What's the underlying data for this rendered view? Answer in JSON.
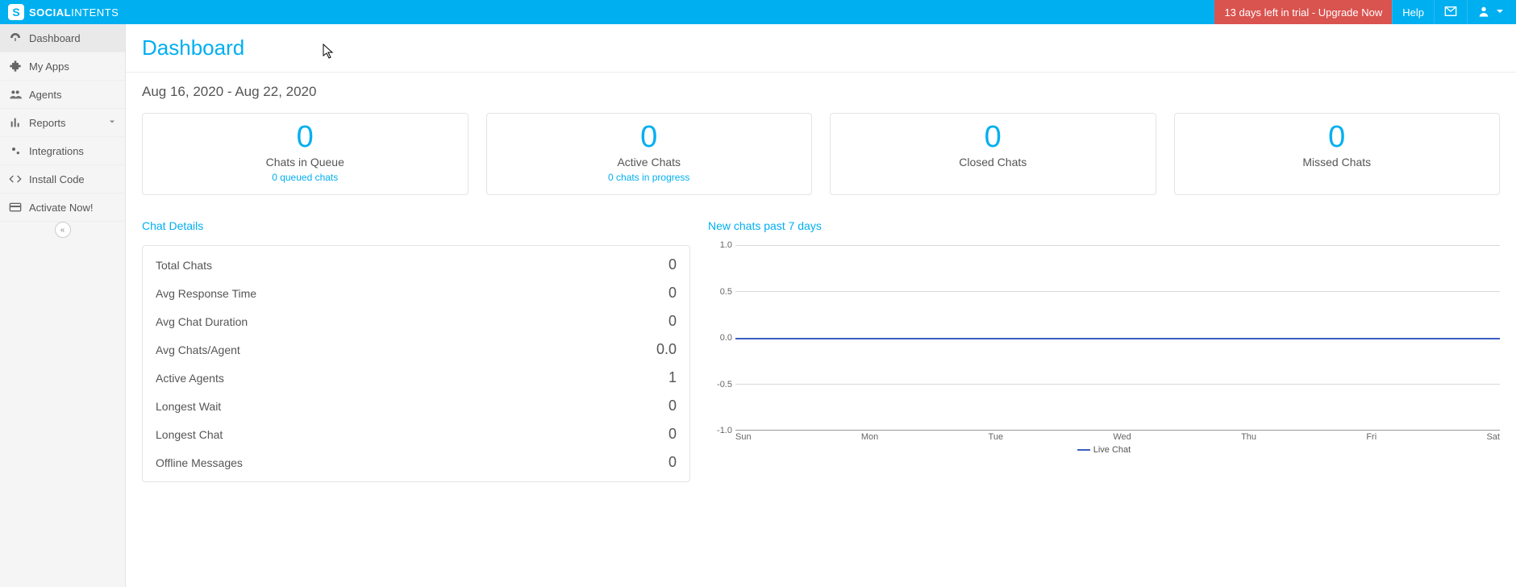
{
  "brand": {
    "name_a": "SOCIAL",
    "name_b": "INTENTS",
    "badge": "S"
  },
  "topbar": {
    "upgrade": "13 days left in trial - Upgrade Now",
    "help": "Help"
  },
  "sidebar": {
    "items": [
      {
        "label": "Dashboard"
      },
      {
        "label": "My Apps"
      },
      {
        "label": "Agents"
      },
      {
        "label": "Reports"
      },
      {
        "label": "Integrations"
      },
      {
        "label": "Install Code"
      },
      {
        "label": "Activate Now!"
      }
    ]
  },
  "page": {
    "title": "Dashboard",
    "date_range": "Aug 16, 2020 - Aug 22, 2020"
  },
  "cards": [
    {
      "value": "0",
      "label": "Chats in Queue",
      "sub": "0 queued chats"
    },
    {
      "value": "0",
      "label": "Active Chats",
      "sub": "0 chats in progress"
    },
    {
      "value": "0",
      "label": "Closed Chats"
    },
    {
      "value": "0",
      "label": "Missed Chats"
    }
  ],
  "chat_details": {
    "title": "Chat Details",
    "rows": [
      {
        "label": "Total Chats",
        "value": "0"
      },
      {
        "label": "Avg Response Time",
        "value": "0"
      },
      {
        "label": "Avg Chat Duration",
        "value": "0"
      },
      {
        "label": "Avg Chats/Agent",
        "value": "0.0"
      },
      {
        "label": "Active Agents",
        "value": "1"
      },
      {
        "label": "Longest Wait",
        "value": "0"
      },
      {
        "label": "Longest Chat",
        "value": "0"
      },
      {
        "label": "Offline Messages",
        "value": "0"
      }
    ]
  },
  "chart_title": "New chats past 7 days",
  "chart_data": {
    "type": "line",
    "title": "New chats past 7 days",
    "xlabel": "",
    "ylabel": "",
    "ylim": [
      -1.0,
      1.0
    ],
    "y_ticks": [
      "1.0",
      "0.5",
      "0.0",
      "-0.5",
      "-1.0"
    ],
    "categories": [
      "Sun",
      "Mon",
      "Tue",
      "Wed",
      "Thu",
      "Fri",
      "Sat"
    ],
    "series": [
      {
        "name": "Live Chat",
        "values": [
          0,
          0,
          0,
          0,
          0,
          0,
          0
        ]
      }
    ],
    "legend": "Live Chat"
  }
}
